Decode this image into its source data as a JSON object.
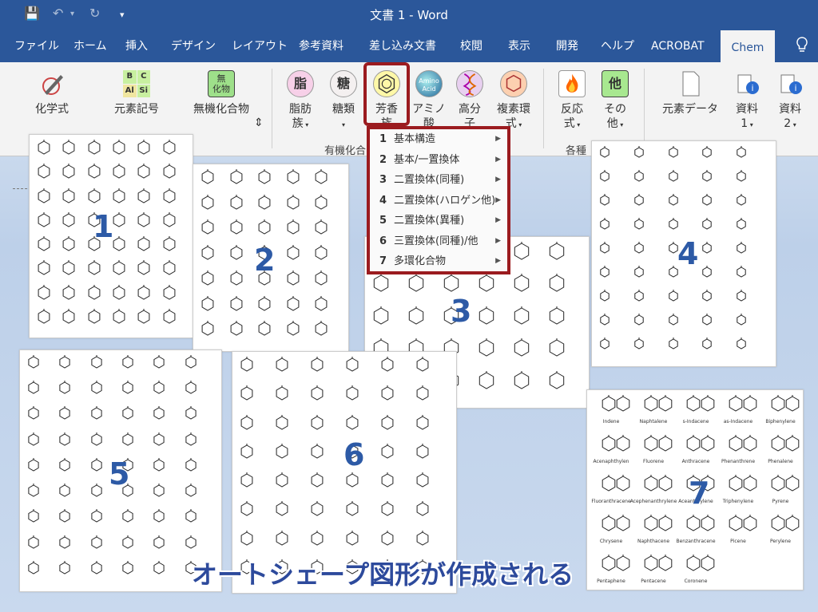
{
  "window": {
    "title": "文書 1  -  Word"
  },
  "quick_access": {
    "save": "💾",
    "undo": "↶",
    "undo_arrow": "▾",
    "redo": "↻",
    "customize": "▾"
  },
  "tabs": [
    "ファイル",
    "ホーム",
    "挿入",
    "デザイン",
    "レイアウト",
    "参考資料",
    "差し込み文書",
    "校閲",
    "表示",
    "開発",
    "ヘルプ",
    "ACROBAT",
    "Chem"
  ],
  "active_tab": "Chem",
  "ribbon": {
    "buttons": [
      {
        "label": "化学式",
        "icon": "pen-icon"
      },
      {
        "label": "元素記号",
        "icon": "periodic-icon",
        "cells": [
          "B",
          "C",
          "Al",
          "Si"
        ]
      },
      {
        "label": "無機化合物",
        "icon": "inorganic-icon",
        "glyph": "無\n化物"
      },
      {
        "label": "脂肪",
        "sub": "族",
        "icon": "fat-icon",
        "glyph": "脂"
      },
      {
        "label": "糖類",
        "icon": "sugar-icon",
        "glyph": "糖"
      },
      {
        "label": "芳香",
        "sub": "族",
        "icon": "aromatic-icon"
      },
      {
        "label": "アミノ",
        "sub": "酸",
        "icon": "amino-icon",
        "glyph": "Amino Acid"
      },
      {
        "label": "高分",
        "sub": "子",
        "icon": "polymer-icon"
      },
      {
        "label": "複素環",
        "sub": "式",
        "icon": "heterocycle-icon"
      },
      {
        "label": "反応",
        "sub": "式",
        "icon": "fire-icon"
      },
      {
        "label": "その",
        "sub": "他",
        "icon": "other-icon",
        "glyph": "他"
      },
      {
        "label": "元素データ",
        "icon": "document-icon"
      },
      {
        "label": "資料",
        "sub": "1",
        "icon": "info-icon"
      },
      {
        "label": "資料",
        "sub": "2",
        "icon": "info-icon"
      }
    ],
    "groups": {
      "organic": "有機化合",
      "other": "各種"
    }
  },
  "menu": [
    {
      "num": "1",
      "label": "基本構造"
    },
    {
      "num": "2",
      "label": "基本/一置換体"
    },
    {
      "num": "3",
      "label": "二置換体(同種)"
    },
    {
      "num": "4",
      "label": "二置換体(ハロゲン他)"
    },
    {
      "num": "5",
      "label": "二置換体(異種)"
    },
    {
      "num": "6",
      "label": "三置換体(同種)/他"
    },
    {
      "num": "7",
      "label": "多環化合物"
    }
  ],
  "panels": [
    {
      "num": "1"
    },
    {
      "num": "2"
    },
    {
      "num": "3"
    },
    {
      "num": "4"
    },
    {
      "num": "5"
    },
    {
      "num": "6"
    },
    {
      "num": "7"
    }
  ],
  "polycyclic_names": [
    "Indene",
    "Naphtalene",
    "s-Indacene",
    "as-Indacene",
    "Biphenylene",
    "Acenaphthylen",
    "Fluorene",
    "Anthracene",
    "Phenanthrene",
    "Phenalene",
    "Fluoranthracene",
    "Acephenanthrylene",
    "Aceanthrylene",
    "Triphenylene",
    "Pyrene",
    "Chrysene",
    "Naphthacene",
    "Benzanthracene",
    "Picene",
    "Perylene",
    "Pentaphene",
    "Pentacene",
    "Coronene"
  ],
  "caption": "オートシェープ図形が作成される",
  "colors": {
    "word_blue": "#2b579a",
    "highlight": "#9b1b1f",
    "panel_number": "#2d5aa6"
  }
}
